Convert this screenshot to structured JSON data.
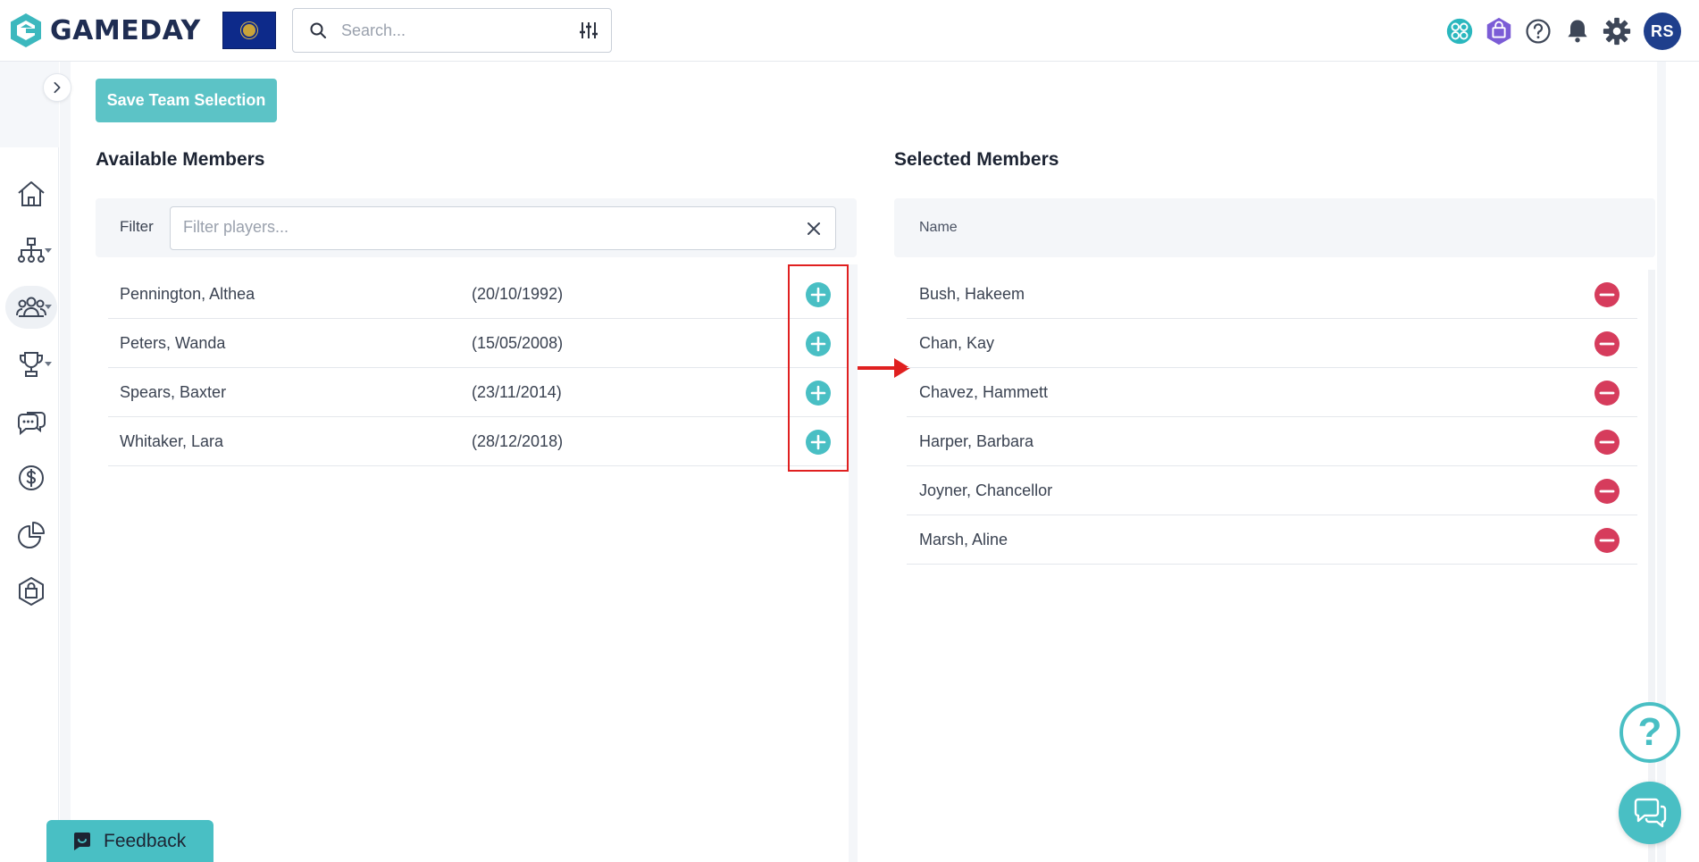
{
  "app": {
    "brand": "GAMEDAY"
  },
  "search": {
    "placeholder": "Search..."
  },
  "header": {
    "avatar_initials": "RS"
  },
  "toolbar": {
    "save_label": "Save Team Selection"
  },
  "available": {
    "title": "Available Members",
    "filter_label": "Filter",
    "filter_placeholder": "Filter players...",
    "filter_value": "",
    "members": [
      {
        "name": "Pennington, Althea",
        "dob": "(20/10/1992)"
      },
      {
        "name": "Peters, Wanda",
        "dob": "(15/05/2008)"
      },
      {
        "name": "Spears, Baxter",
        "dob": "(23/11/2014)"
      },
      {
        "name": "Whitaker, Lara",
        "dob": "(28/12/2018)"
      }
    ]
  },
  "selected": {
    "title": "Selected Members",
    "column_header": "Name",
    "members": [
      {
        "name": "Bush, Hakeem"
      },
      {
        "name": "Chan, Kay"
      },
      {
        "name": "Chavez, Hammett"
      },
      {
        "name": "Harper, Barbara"
      },
      {
        "name": "Joyner, Chancellor"
      },
      {
        "name": "Marsh, Aline"
      }
    ]
  },
  "widgets": {
    "help_symbol": "?",
    "feedback_label": "Feedback"
  },
  "icons": {
    "top_right": [
      "network-icon",
      "shop-icon",
      "help-icon",
      "bell-icon",
      "gear-icon"
    ],
    "sidebar": [
      "home-icon",
      "hierarchy-icon",
      "members-icon",
      "trophy-icon",
      "chat-icon",
      "dollar-icon",
      "reports-icon",
      "shop-icon"
    ]
  },
  "colors": {
    "accent_teal": "#49bfc4",
    "remove_red": "#d63c5c",
    "brand_navy": "#1f2d52",
    "annotation_red": "#e02020"
  }
}
